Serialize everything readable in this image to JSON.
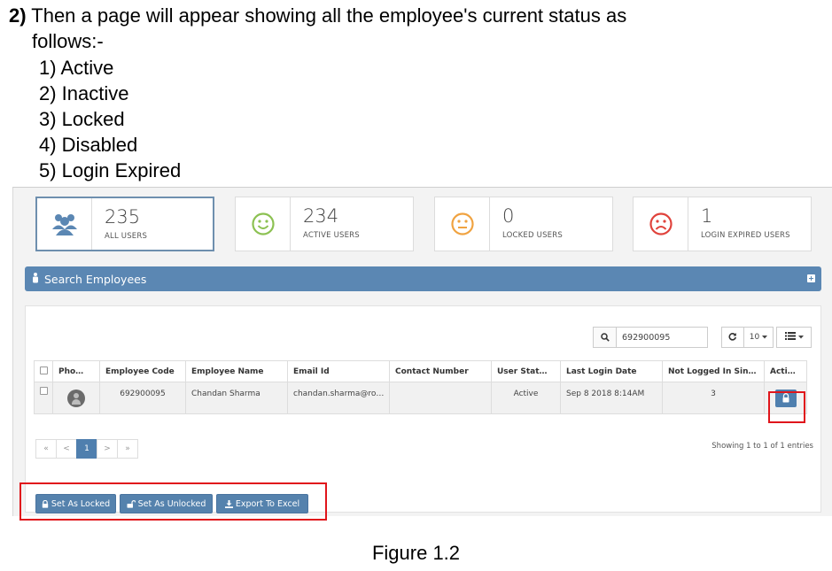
{
  "doc": {
    "step_number": "2)",
    "heading_line1": " Then a page will appear showing all the employee's current status as",
    "heading_line2": "follows:-",
    "statuses": [
      "1) Active",
      "2) Inactive",
      "3) Locked",
      "4) Disabled",
      "5) Login Expired"
    ],
    "caption": "Figure 1.2"
  },
  "stats": [
    {
      "value": "235",
      "label": "ALL USERS",
      "icon": "users-group-icon",
      "color": "#5b87b3"
    },
    {
      "value": "234",
      "label": "ACTIVE USERS",
      "icon": "smile-face-icon",
      "color": "#8cc152"
    },
    {
      "value": "0",
      "label": "LOCKED USERS",
      "icon": "neutral-face-icon",
      "color": "#f0a341"
    },
    {
      "value": "1",
      "label": "LOGIN EXPIRED USERS",
      "icon": "sad-face-icon",
      "color": "#e0433c"
    }
  ],
  "search_panel": {
    "title": "Search Employees"
  },
  "toolbar": {
    "search_value": "692900095",
    "page_size": "10"
  },
  "table": {
    "columns": [
      "Pho…",
      "Employee Code",
      "Employee Name",
      "Email Id",
      "Contact Number",
      "User Stat…",
      "Last Login Date",
      "Not Logged In Sin…",
      "Acti…"
    ],
    "rows": [
      {
        "code": "692900095",
        "name": "Chandan Sharma",
        "email": "chandan.sharma@ro…",
        "contact": "",
        "status": "Active",
        "last_login": "Sep 8 2018 8:14AM",
        "not_logged": "3"
      }
    ]
  },
  "pager": {
    "first": "«",
    "prev": "<",
    "current": "1",
    "next": ">",
    "last": "»"
  },
  "showing_text": "Showing 1 to 1 of 1 entries",
  "actions": {
    "lock": "Set As Locked",
    "unlock": "Set As Unlocked",
    "export": "Export To Excel"
  },
  "colors": {
    "accent": "#5b87b3",
    "highlight": "#e0151b"
  }
}
